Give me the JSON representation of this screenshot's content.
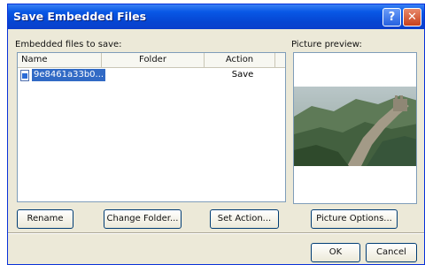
{
  "dialog": {
    "title": "Save Embedded Files",
    "help_label": "?",
    "close_label": "✕"
  },
  "files_section": {
    "label": "Embedded files to save:",
    "columns": {
      "name": "Name",
      "folder": "Folder",
      "action": "Action"
    },
    "rows": [
      {
        "name": "9e8461a33b0...",
        "folder": "",
        "action": "Save",
        "icon": "file-icon",
        "selected": true
      }
    ]
  },
  "preview_section": {
    "label": "Picture preview:",
    "image": "great-wall-photo"
  },
  "buttons": {
    "rename": "Rename",
    "change_folder": "Change Folder...",
    "set_action": "Set Action...",
    "picture_options": "Picture Options...",
    "ok": "OK",
    "cancel": "Cancel"
  },
  "colors": {
    "titlebar": "#0a54e3",
    "selection": "#316ac5",
    "dialog_bg": "#ece9d8"
  }
}
